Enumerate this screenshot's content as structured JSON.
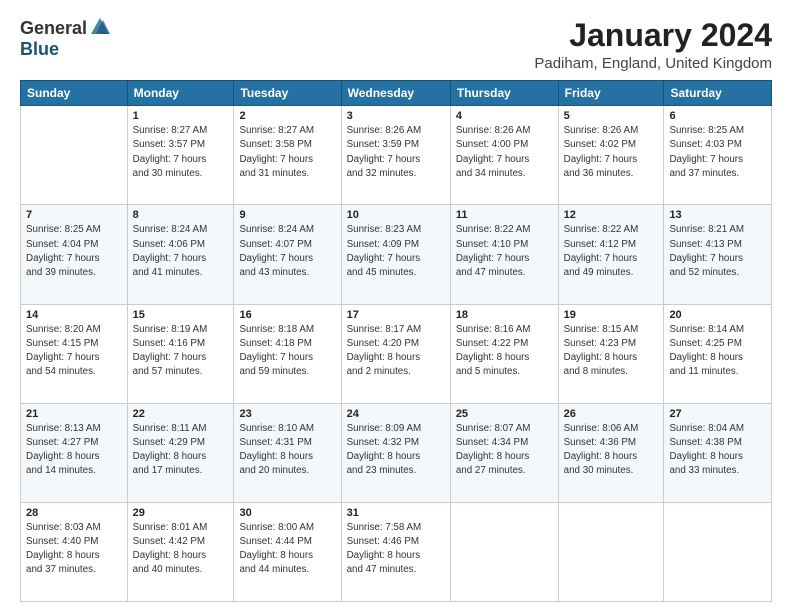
{
  "header": {
    "logo": {
      "general": "General",
      "blue": "Blue"
    },
    "title": "January 2024",
    "location": "Padiham, England, United Kingdom"
  },
  "days_of_week": [
    "Sunday",
    "Monday",
    "Tuesday",
    "Wednesday",
    "Thursday",
    "Friday",
    "Saturday"
  ],
  "weeks": [
    [
      {
        "num": "",
        "info": ""
      },
      {
        "num": "1",
        "info": "Sunrise: 8:27 AM\nSunset: 3:57 PM\nDaylight: 7 hours\nand 30 minutes."
      },
      {
        "num": "2",
        "info": "Sunrise: 8:27 AM\nSunset: 3:58 PM\nDaylight: 7 hours\nand 31 minutes."
      },
      {
        "num": "3",
        "info": "Sunrise: 8:26 AM\nSunset: 3:59 PM\nDaylight: 7 hours\nand 32 minutes."
      },
      {
        "num": "4",
        "info": "Sunrise: 8:26 AM\nSunset: 4:00 PM\nDaylight: 7 hours\nand 34 minutes."
      },
      {
        "num": "5",
        "info": "Sunrise: 8:26 AM\nSunset: 4:02 PM\nDaylight: 7 hours\nand 36 minutes."
      },
      {
        "num": "6",
        "info": "Sunrise: 8:25 AM\nSunset: 4:03 PM\nDaylight: 7 hours\nand 37 minutes."
      }
    ],
    [
      {
        "num": "7",
        "info": "Sunrise: 8:25 AM\nSunset: 4:04 PM\nDaylight: 7 hours\nand 39 minutes."
      },
      {
        "num": "8",
        "info": "Sunrise: 8:24 AM\nSunset: 4:06 PM\nDaylight: 7 hours\nand 41 minutes."
      },
      {
        "num": "9",
        "info": "Sunrise: 8:24 AM\nSunset: 4:07 PM\nDaylight: 7 hours\nand 43 minutes."
      },
      {
        "num": "10",
        "info": "Sunrise: 8:23 AM\nSunset: 4:09 PM\nDaylight: 7 hours\nand 45 minutes."
      },
      {
        "num": "11",
        "info": "Sunrise: 8:22 AM\nSunset: 4:10 PM\nDaylight: 7 hours\nand 47 minutes."
      },
      {
        "num": "12",
        "info": "Sunrise: 8:22 AM\nSunset: 4:12 PM\nDaylight: 7 hours\nand 49 minutes."
      },
      {
        "num": "13",
        "info": "Sunrise: 8:21 AM\nSunset: 4:13 PM\nDaylight: 7 hours\nand 52 minutes."
      }
    ],
    [
      {
        "num": "14",
        "info": "Sunrise: 8:20 AM\nSunset: 4:15 PM\nDaylight: 7 hours\nand 54 minutes."
      },
      {
        "num": "15",
        "info": "Sunrise: 8:19 AM\nSunset: 4:16 PM\nDaylight: 7 hours\nand 57 minutes."
      },
      {
        "num": "16",
        "info": "Sunrise: 8:18 AM\nSunset: 4:18 PM\nDaylight: 7 hours\nand 59 minutes."
      },
      {
        "num": "17",
        "info": "Sunrise: 8:17 AM\nSunset: 4:20 PM\nDaylight: 8 hours\nand 2 minutes."
      },
      {
        "num": "18",
        "info": "Sunrise: 8:16 AM\nSunset: 4:22 PM\nDaylight: 8 hours\nand 5 minutes."
      },
      {
        "num": "19",
        "info": "Sunrise: 8:15 AM\nSunset: 4:23 PM\nDaylight: 8 hours\nand 8 minutes."
      },
      {
        "num": "20",
        "info": "Sunrise: 8:14 AM\nSunset: 4:25 PM\nDaylight: 8 hours\nand 11 minutes."
      }
    ],
    [
      {
        "num": "21",
        "info": "Sunrise: 8:13 AM\nSunset: 4:27 PM\nDaylight: 8 hours\nand 14 minutes."
      },
      {
        "num": "22",
        "info": "Sunrise: 8:11 AM\nSunset: 4:29 PM\nDaylight: 8 hours\nand 17 minutes."
      },
      {
        "num": "23",
        "info": "Sunrise: 8:10 AM\nSunset: 4:31 PM\nDaylight: 8 hours\nand 20 minutes."
      },
      {
        "num": "24",
        "info": "Sunrise: 8:09 AM\nSunset: 4:32 PM\nDaylight: 8 hours\nand 23 minutes."
      },
      {
        "num": "25",
        "info": "Sunrise: 8:07 AM\nSunset: 4:34 PM\nDaylight: 8 hours\nand 27 minutes."
      },
      {
        "num": "26",
        "info": "Sunrise: 8:06 AM\nSunset: 4:36 PM\nDaylight: 8 hours\nand 30 minutes."
      },
      {
        "num": "27",
        "info": "Sunrise: 8:04 AM\nSunset: 4:38 PM\nDaylight: 8 hours\nand 33 minutes."
      }
    ],
    [
      {
        "num": "28",
        "info": "Sunrise: 8:03 AM\nSunset: 4:40 PM\nDaylight: 8 hours\nand 37 minutes."
      },
      {
        "num": "29",
        "info": "Sunrise: 8:01 AM\nSunset: 4:42 PM\nDaylight: 8 hours\nand 40 minutes."
      },
      {
        "num": "30",
        "info": "Sunrise: 8:00 AM\nSunset: 4:44 PM\nDaylight: 8 hours\nand 44 minutes."
      },
      {
        "num": "31",
        "info": "Sunrise: 7:58 AM\nSunset: 4:46 PM\nDaylight: 8 hours\nand 47 minutes."
      },
      {
        "num": "",
        "info": ""
      },
      {
        "num": "",
        "info": ""
      },
      {
        "num": "",
        "info": ""
      }
    ]
  ]
}
